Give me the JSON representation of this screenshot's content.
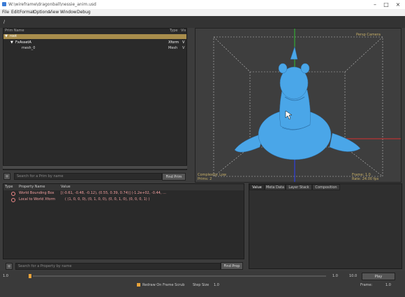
{
  "window": {
    "title": "W:\\wireframe\\dragonball\\nessie_anim.usd"
  },
  "menu": [
    "File",
    "Edit",
    "Format",
    "Options",
    "View",
    "Window",
    "Debug"
  ],
  "path_bar": {
    "path": "/"
  },
  "hierarchy": {
    "columns": {
      "name": "Prim Name",
      "type": "Type",
      "vis": "Vis"
    },
    "rows": [
      {
        "name": "root",
        "type": "",
        "vis": ""
      },
      {
        "name": "FxAssetA",
        "type": "Xform",
        "vis": "V"
      },
      {
        "name": "mesh_0",
        "type": "Mesh",
        "vis": "V"
      }
    ],
    "search_placeholder": "Search for a Prim by name",
    "expand_label": "+",
    "find_label": "Find Prim"
  },
  "viewport": {
    "top_right_label": "Persp Camera",
    "bottom_left_lines": [
      "Complexity: Low",
      "Prims: 2"
    ],
    "bottom_right_lines": [
      "Frame: 1.0",
      "Rate: 24.00 fps"
    ]
  },
  "properties": {
    "columns": {
      "type": "Type",
      "name": "Property Name",
      "value": "Value"
    },
    "rows": [
      {
        "name": "World Bounding Box",
        "value": "[(-0.61, -0.48, -0.12), (0.55, 0.39, 0.74)]   (-1.2e+02, -0.44, ..."
      },
      {
        "name": "Local to World Xform",
        "value": "( (1, 0, 0, 0), (0, 1, 0, 0), (0, 0, 1, 0), (0, 0, 0, 1) )"
      }
    ],
    "search_placeholder": "Search for a Property by name",
    "find_label": "Find Prop"
  },
  "tabs": [
    "Value",
    "Meta Data",
    "Layer Stack",
    "Composition"
  ],
  "timeline": {
    "start": "1.0",
    "current": "1.0",
    "end": "10.0",
    "play_label": "Play",
    "redraw_label": "Redraw On Frame Scrub",
    "step_size_label": "Step Size",
    "step_size_value": "1.0",
    "frame_label": "Frame:",
    "frame_value": "1.0",
    "accent": "#e8a33a"
  },
  "colors": {
    "selection": "#a88d4c",
    "warning_text": "#f2a0a0",
    "axis_x": "#d83030",
    "axis_y": "#30c030",
    "axis_z": "#3040e0",
    "model": "#4aa6e8"
  }
}
